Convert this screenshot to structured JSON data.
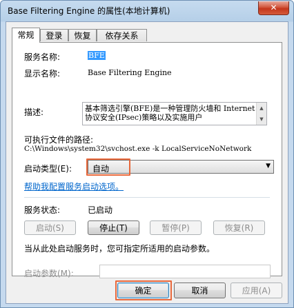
{
  "window": {
    "title": "Base Filtering Engine 的属性(本地计算机)",
    "close_glyph": "✕"
  },
  "tabs": [
    {
      "label": "常规"
    },
    {
      "label": "登录"
    },
    {
      "label": "恢复"
    },
    {
      "label": "依存关系"
    }
  ],
  "general": {
    "service_name_label": "服务名称:",
    "service_name_value": "BFE",
    "display_name_label": "显示名称:",
    "display_name_value": "Base Filtering Engine",
    "description_label": "描述:",
    "description_value": "基本筛选引擎(BFE)是一种管理防火墙和 Internet 协议安全(IPsec)策略以及实施用户",
    "exe_path_label": "可执行文件的路径:",
    "exe_path_value": "C:\\Windows\\system32\\svchost.exe -k LocalServiceNoNetwork",
    "startup_type_label": "启动类型(E):",
    "startup_type_value": "自动",
    "help_link": "帮助我配置服务启动选项。",
    "status_label": "服务状态:",
    "status_value": "已启动",
    "start_button": "启动(S)",
    "stop_button": "停止(T)",
    "pause_button": "暂停(P)",
    "resume_button": "恢复(R)",
    "hint_text": "当从此处启动服务时，您可指定所适用的启动参数。",
    "start_params_label": "启动参数(M):",
    "start_params_value": ""
  },
  "footer": {
    "ok_button": "确定",
    "cancel_button": "取消",
    "apply_button": "应用(A)"
  },
  "colors": {
    "highlight": "#e8673a",
    "link": "#0066cc",
    "selection": "#3399ff"
  }
}
